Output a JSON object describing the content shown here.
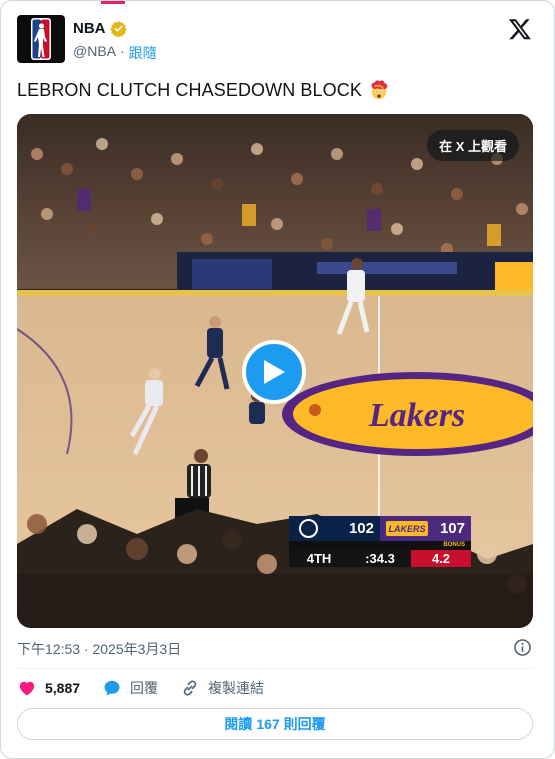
{
  "account": {
    "name": "NBA",
    "handle": "@NBA",
    "separator": "·",
    "follow_label": "跟隨"
  },
  "tweet": {
    "text": "LEBRON CLUTCH CHASEDOWN BLOCK"
  },
  "video": {
    "watch_on_x_label": "在 X 上觀看",
    "scoreboard": {
      "away_score": "102",
      "home_score": "107",
      "home_logo_text": "LAKERS",
      "bonus_label": "BONUS",
      "quarter": "4TH",
      "clock": ":34.3",
      "shot_clock": "4.2"
    }
  },
  "meta": {
    "timestamp": "下午12:53 · 2025年3月3日"
  },
  "actions": {
    "likes": "5,887",
    "reply_label": "回覆",
    "copy_link_label": "複製連結"
  },
  "read_replies": {
    "prefix": "閱讀",
    "count": "167",
    "suffix": "則回覆"
  },
  "colors": {
    "accent": "#1d9bf0",
    "like": "#f91880",
    "text": "#0f1419",
    "muted": "#536471"
  }
}
